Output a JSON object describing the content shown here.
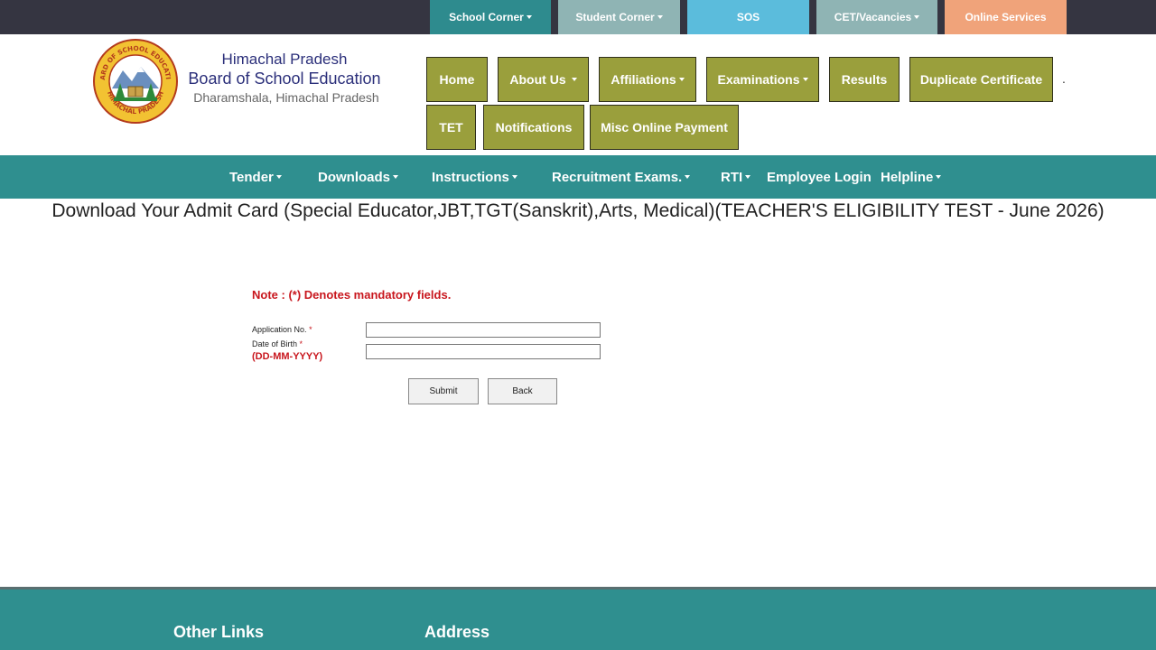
{
  "top_nav": [
    {
      "label": "School Corner",
      "dropdown": true,
      "color": "#2e8b8e"
    },
    {
      "label": "Student Corner",
      "dropdown": true,
      "color": "#8fb4b4"
    },
    {
      "label": "SOS",
      "dropdown": false,
      "color": "#5bbcdc"
    },
    {
      "label": "CET/Vacancies",
      "dropdown": true,
      "color": "#8fb4b4"
    },
    {
      "label": "Online Services",
      "dropdown": false,
      "color": "#f0a37a"
    }
  ],
  "header": {
    "org_line1": "Himachal Pradesh",
    "org_line2": "Board of School Education",
    "org_line3": "Dharamshala, Himachal Pradesh",
    "logo_text_top": "BOARD OF SCHOOL EDUCATION",
    "logo_text_bottom": "HIMACHAL PRADESH"
  },
  "main_nav": [
    {
      "label": "Home",
      "dropdown": false
    },
    {
      "label": "About Us",
      "dropdown": true
    },
    {
      "label": "Affiliations",
      "dropdown": true
    },
    {
      "label": "Examinations",
      "dropdown": true
    },
    {
      "label": "Results",
      "dropdown": false
    },
    {
      "label": "Duplicate Certificate",
      "dropdown": false
    },
    {
      "label": "TET",
      "dropdown": false
    },
    {
      "label": "Notifications",
      "dropdown": false
    },
    {
      "label": "Misc Online Payment",
      "dropdown": false
    }
  ],
  "secondary_nav": [
    {
      "label": "Tender",
      "dropdown": true
    },
    {
      "label": "Downloads",
      "dropdown": true
    },
    {
      "label": "Instructions",
      "dropdown": true
    },
    {
      "label": "Recruitment Exams.",
      "dropdown": true
    },
    {
      "label": "RTI",
      "dropdown": true
    },
    {
      "label": "Employee Login",
      "dropdown": false
    },
    {
      "label": "Helpline",
      "dropdown": true
    }
  ],
  "page": {
    "title": "Download Your Admit Card (Special Educator,JBT,TGT(Sanskrit),Arts, Medical)(TEACHER'S ELIGIBILITY TEST - June 2026)",
    "note": "Note  : (*) Denotes mandatory fields."
  },
  "form": {
    "application_no_label": "Application No.",
    "application_no_value": "",
    "dob_label": "Date of Birth",
    "dob_format": "(DD-MM-YYYY)",
    "dob_value": "",
    "required_mark": "*",
    "submit_label": "Submit",
    "back_label": "Back"
  },
  "footer": {
    "other_links_title": "Other Links",
    "address_title": "Address"
  },
  "colors": {
    "topbar_bg": "#353541",
    "nav_olive": "#9a9f3c",
    "teal": "#2f8f8f",
    "required_red": "#c8161d",
    "org_blue": "#2b2f7a"
  }
}
